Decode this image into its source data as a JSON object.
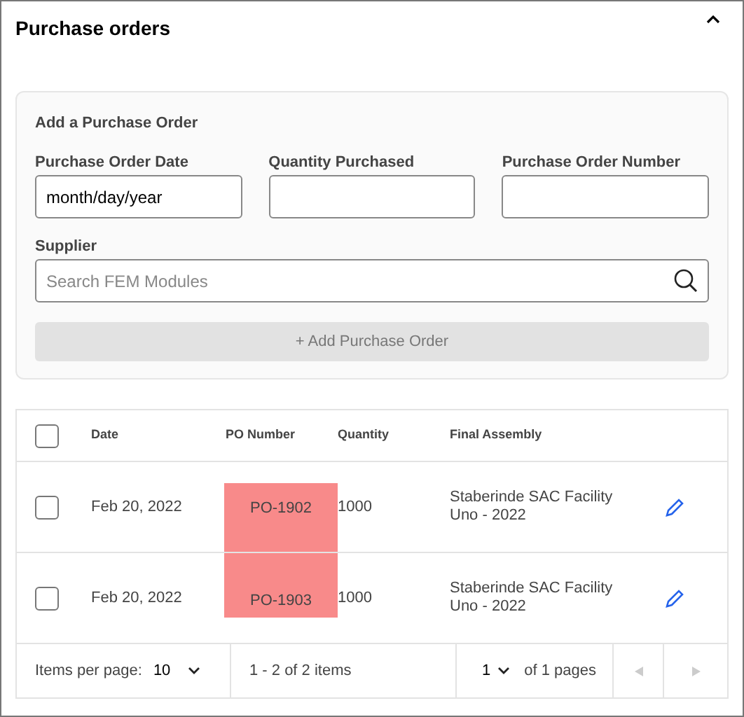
{
  "section": {
    "title": "Purchase orders",
    "expanded": true
  },
  "form": {
    "title": "Add a Purchase Order",
    "fields": [
      {
        "label": "Purchase Order Date",
        "value": "month/day/year"
      },
      {
        "label": "Quantity Purchased"
      },
      {
        "label": "Purchase Order Number"
      }
    ],
    "supplier": {
      "label": "Supplier",
      "placeholder": "Search FEM Modules"
    },
    "add_button": {
      "label": "+ Add Purchase Order",
      "disabled": true
    }
  },
  "table": {
    "all_checked": false,
    "columns": [
      "Date",
      "PO Number",
      "Quantity",
      "Final Assembly"
    ],
    "rows": [
      {
        "checked": false,
        "date": "Feb 20, 2022",
        "po_number": "PO-1902",
        "highlighted": true,
        "quantity": "1000",
        "final_assembly": "Staberinde SAC Facility Uno - 2022"
      },
      {
        "checked": false,
        "date": "Feb 20, 2022",
        "po_number": "PO-1903",
        "highlighted": true,
        "quantity": "1000",
        "final_assembly": "Staberinde SAC Facility Uno - 2022"
      }
    ]
  },
  "pager": {
    "items_per_page_label": "Items per page:",
    "items_per_page": "10",
    "range": "1 - 2 of 2 items",
    "page": "1",
    "of_pages": "of 1 pages",
    "prev_disabled": true,
    "next_disabled": true
  }
}
